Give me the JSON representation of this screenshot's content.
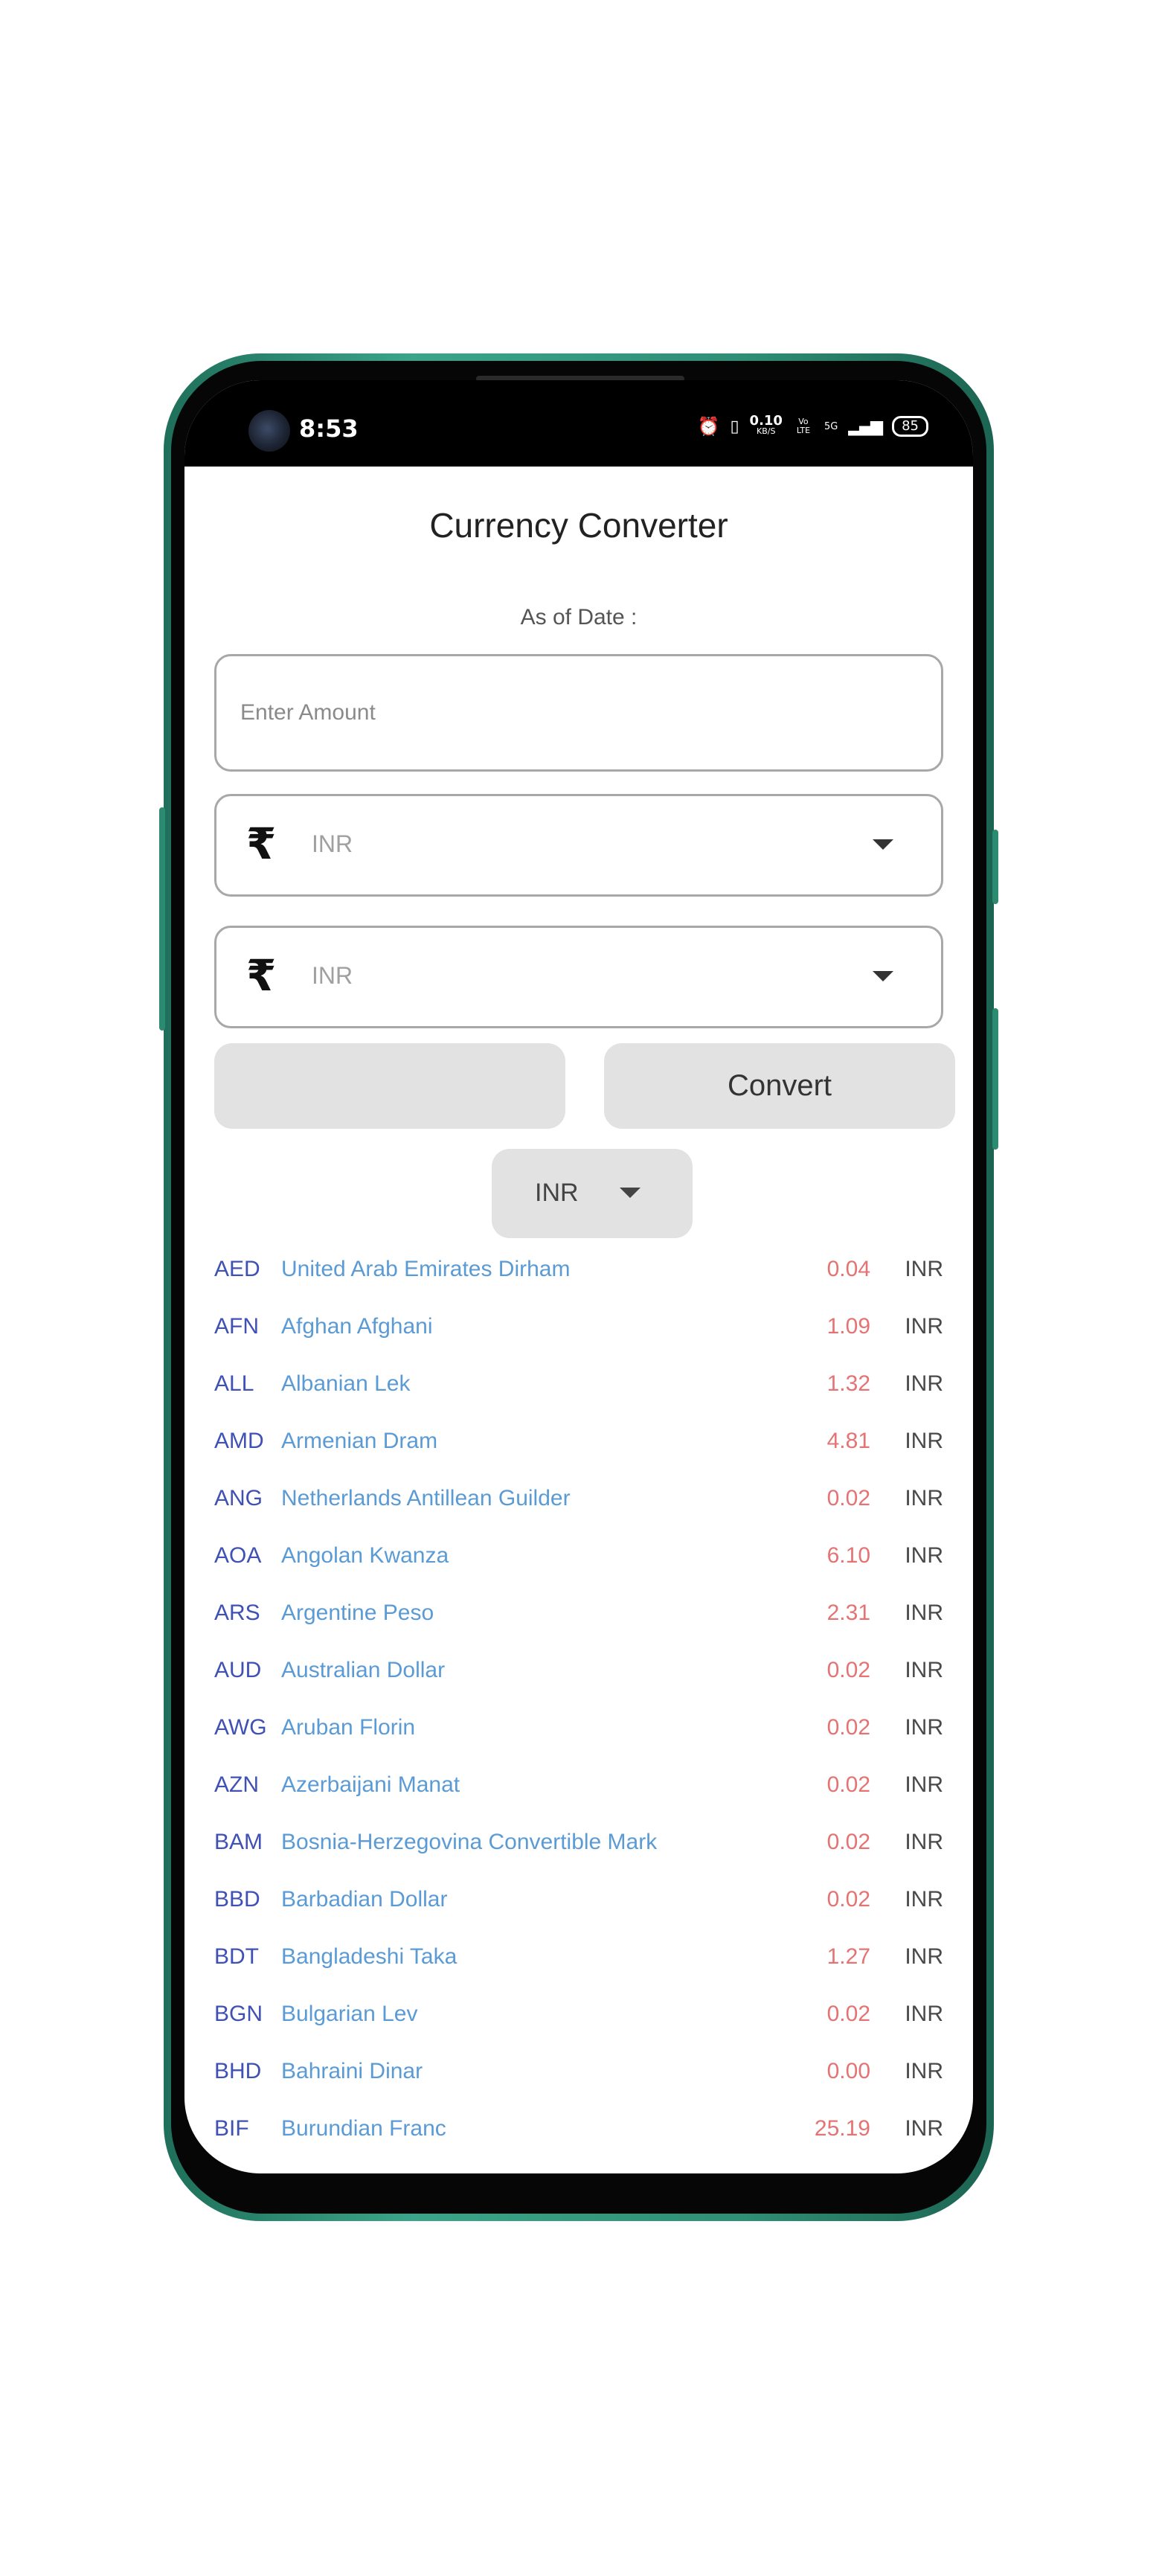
{
  "status_bar": {
    "time": "8:53",
    "net_speed": "0.10",
    "net_unit": "KB/S",
    "volte": "Vo LTE",
    "network": "5G",
    "battery": "85"
  },
  "app": {
    "title": "Currency Converter",
    "as_of_label": "As of Date :",
    "amount_placeholder": "Enter Amount",
    "from_currency": {
      "symbol": "₹",
      "code": "INR"
    },
    "to_currency": {
      "symbol": "₹",
      "code": "INR"
    },
    "left_button_label": "",
    "convert_label": "Convert",
    "base_currency": "INR"
  },
  "rates": [
    {
      "code": "AED",
      "name": "United Arab Emirates Dirham",
      "value": "0.04",
      "target": "INR"
    },
    {
      "code": "AFN",
      "name": "Afghan Afghani",
      "value": "1.09",
      "target": "INR"
    },
    {
      "code": "ALL",
      "name": "Albanian Lek",
      "value": "1.32",
      "target": "INR"
    },
    {
      "code": "AMD",
      "name": "Armenian Dram",
      "value": "4.81",
      "target": "INR"
    },
    {
      "code": "ANG",
      "name": "Netherlands Antillean Guilder",
      "value": "0.02",
      "target": "INR"
    },
    {
      "code": "AOA",
      "name": "Angolan Kwanza",
      "value": "6.10",
      "target": "INR"
    },
    {
      "code": "ARS",
      "name": "Argentine Peso",
      "value": "2.31",
      "target": "INR"
    },
    {
      "code": "AUD",
      "name": "Australian Dollar",
      "value": "0.02",
      "target": "INR"
    },
    {
      "code": "AWG",
      "name": "Aruban Florin",
      "value": "0.02",
      "target": "INR"
    },
    {
      "code": "AZN",
      "name": "Azerbaijani Manat",
      "value": "0.02",
      "target": "INR"
    },
    {
      "code": "BAM",
      "name": "Bosnia-Herzegovina Convertible Mark",
      "value": "0.02",
      "target": "INR"
    },
    {
      "code": "BBD",
      "name": "Barbadian Dollar",
      "value": "0.02",
      "target": "INR"
    },
    {
      "code": "BDT",
      "name": "Bangladeshi Taka",
      "value": "1.27",
      "target": "INR"
    },
    {
      "code": "BGN",
      "name": "Bulgarian Lev",
      "value": "0.02",
      "target": "INR"
    },
    {
      "code": "BHD",
      "name": "Bahraini Dinar",
      "value": "0.00",
      "target": "INR"
    },
    {
      "code": "BIF",
      "name": "Burundian Franc",
      "value": "25.19",
      "target": "INR"
    }
  ]
}
